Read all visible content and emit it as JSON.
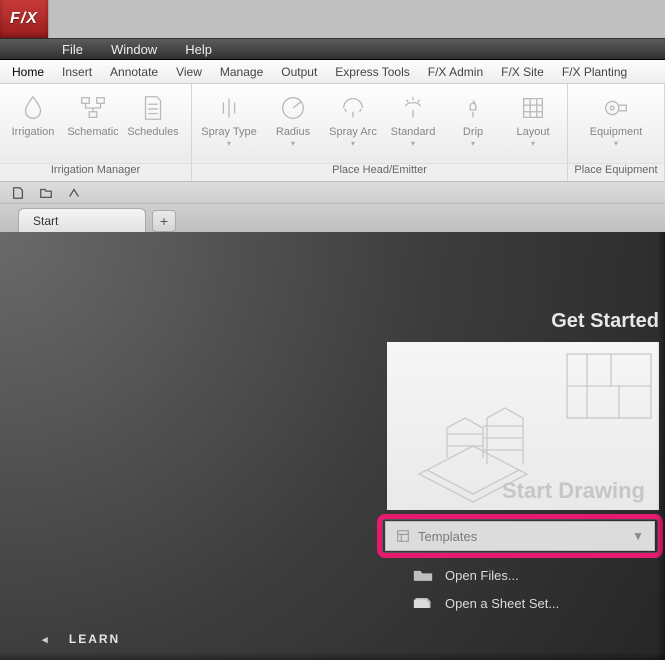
{
  "app": {
    "logo_text": "F/X"
  },
  "menubar": [
    "File",
    "Window",
    "Help"
  ],
  "ribbon_tabs": [
    "Home",
    "Insert",
    "Annotate",
    "View",
    "Manage",
    "Output",
    "Express Tools",
    "F/X Admin",
    "F/X Site",
    "F/X Planting"
  ],
  "ribbon": {
    "panels": [
      {
        "title": "Irrigation Manager",
        "items": [
          {
            "label": "Irrigation",
            "icon": "drop"
          },
          {
            "label": "Schematic",
            "icon": "schematic"
          },
          {
            "label": "Schedules",
            "icon": "document"
          }
        ]
      },
      {
        "title": "Place Head/Emitter",
        "items": [
          {
            "label": "Spray Type",
            "icon": "spray-type",
            "dd": true
          },
          {
            "label": "Radius",
            "icon": "radius",
            "dd": true
          },
          {
            "label": "Spray Arc",
            "icon": "spray-arc",
            "dd": true
          },
          {
            "label": "Standard",
            "icon": "standard",
            "dd": true
          },
          {
            "label": "Drip",
            "icon": "drip",
            "dd": true
          },
          {
            "label": "Layout",
            "icon": "grid",
            "dd": true
          }
        ]
      },
      {
        "title": "Place Equipment",
        "items": [
          {
            "label": "Equipment",
            "icon": "equipment",
            "dd": true
          }
        ]
      }
    ]
  },
  "doctabs": {
    "start": "Start",
    "new": "+"
  },
  "start_area": {
    "heading": "Get Started",
    "card_label": "Start Drawing",
    "templates_label": "Templates",
    "open_files": "Open Files...",
    "open_sheet": "Open a Sheet Set...",
    "learn": "LEARN"
  },
  "colors": {
    "highlight": "#e61a6e"
  }
}
